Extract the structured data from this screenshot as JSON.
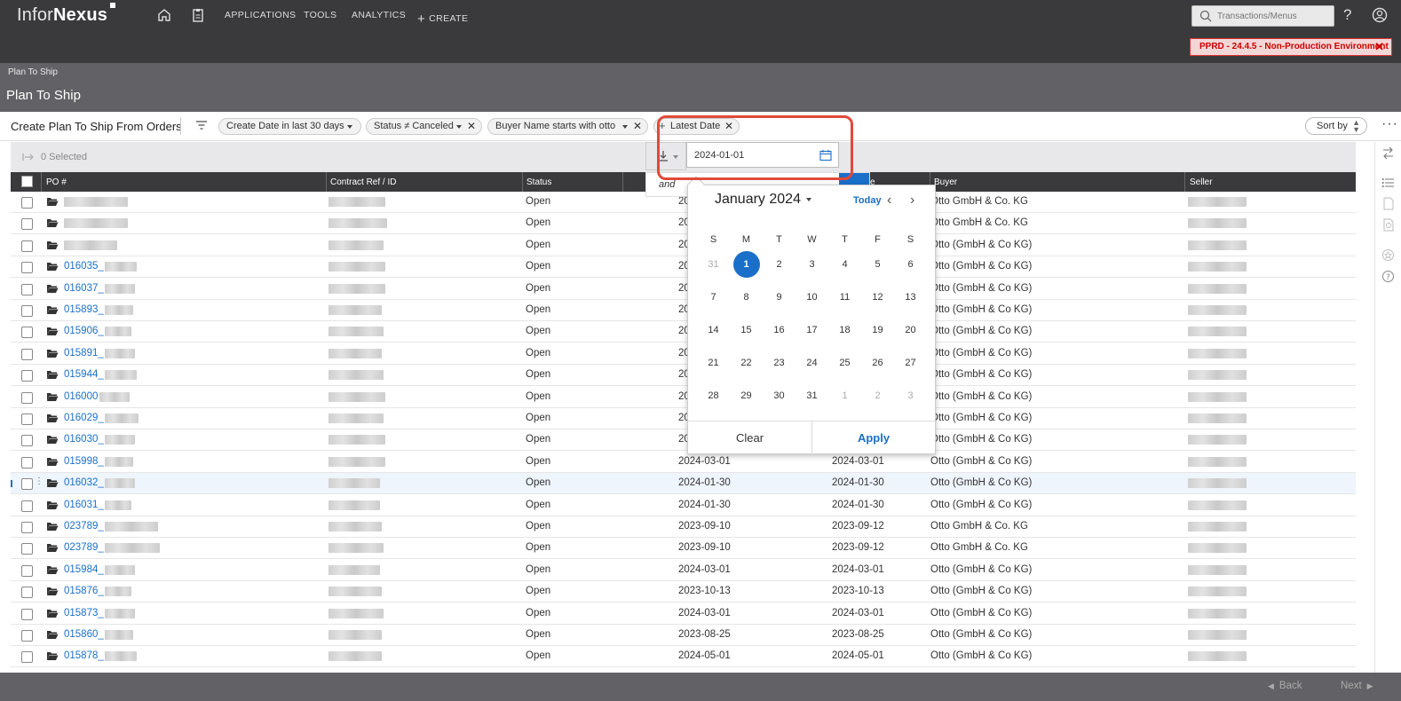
{
  "brand": {
    "part1": "Infor",
    "part2": "Nexus"
  },
  "nav": {
    "applications": "APPLICATIONS",
    "tools": "TOOLS",
    "analytics": "ANALYTICS",
    "create": "CREATE"
  },
  "search": {
    "placeholder": "Transactions/Menus"
  },
  "env_badge": "PPRD - 24.4.5 - Non-Production Environment",
  "breadcrumb": "Plan To Ship",
  "page_title": "Plan To Ship",
  "filterbar": {
    "title": "Create Plan To Ship From Orders",
    "chips": {
      "create_date": "Create Date in last 30 days",
      "status": "Status ≠ Canceled",
      "buyer_name": "Buyer Name starts with otto",
      "latest_date": "Latest Date"
    },
    "sort_by": "Sort by"
  },
  "selection": {
    "text": "0 Selected"
  },
  "columns": {
    "po": "PO #",
    "contract": "Contract Ref / ID",
    "status": "Status",
    "col_e": "e",
    "buyer": "Buyer",
    "seller": "Seller"
  },
  "date_filter": {
    "and_label": "and",
    "value": "2024-01-01",
    "calendar": {
      "month": "January 2024",
      "today": "Today",
      "weekdays": [
        "S",
        "M",
        "T",
        "W",
        "T",
        "F",
        "S"
      ],
      "weeks": [
        [
          "31",
          "1",
          "2",
          "3",
          "4",
          "5",
          "6"
        ],
        [
          "7",
          "8",
          "9",
          "10",
          "11",
          "12",
          "13"
        ],
        [
          "14",
          "15",
          "16",
          "17",
          "18",
          "19",
          "20"
        ],
        [
          "21",
          "22",
          "23",
          "24",
          "25",
          "26",
          "27"
        ],
        [
          "28",
          "29",
          "30",
          "31",
          "1",
          "2",
          "3"
        ]
      ],
      "selected_day": "1",
      "clear": "Clear",
      "apply": "Apply"
    }
  },
  "rows": [
    {
      "po": "",
      "status": "Open",
      "d1": "20",
      "d2": "",
      "buyer": "Otto GmbH & Co. KG"
    },
    {
      "po": "",
      "status": "Open",
      "d1": "20",
      "d2": "",
      "buyer": "Otto GmbH & Co. KG"
    },
    {
      "po": "",
      "status": "Open",
      "d1": "20",
      "d2": "",
      "buyer": "Otto (GmbH & Co KG)"
    },
    {
      "po": "016035_",
      "status": "Open",
      "d1": "20",
      "d2": "",
      "buyer": "Otto (GmbH & Co KG)"
    },
    {
      "po": "016037_",
      "status": "Open",
      "d1": "20",
      "d2": "",
      "buyer": "Otto (GmbH & Co KG)"
    },
    {
      "po": "015893_",
      "status": "Open",
      "d1": "20",
      "d2": "",
      "buyer": "Otto (GmbH & Co KG)"
    },
    {
      "po": "015906_",
      "status": "Open",
      "d1": "20",
      "d2": "",
      "buyer": "Otto (GmbH & Co KG)"
    },
    {
      "po": "015891_",
      "status": "Open",
      "d1": "20",
      "d2": "",
      "buyer": "Otto (GmbH & Co KG)"
    },
    {
      "po": "015944_",
      "status": "Open",
      "d1": "20",
      "d2": "",
      "buyer": "Otto (GmbH & Co KG)"
    },
    {
      "po": "016000",
      "status": "Open",
      "d1": "20",
      "d2": "",
      "buyer": "Otto (GmbH & Co KG)"
    },
    {
      "po": "016029_",
      "status": "Open",
      "d1": "20",
      "d2": "",
      "buyer": "Otto (GmbH & Co KG)"
    },
    {
      "po": "016030_",
      "status": "Open",
      "d1": "20",
      "d2": "",
      "buyer": "Otto (GmbH & Co KG)"
    },
    {
      "po": "015998_",
      "status": "Open",
      "d1": "2024-03-01",
      "d2": "2024-03-01",
      "buyer": "Otto (GmbH & Co KG)"
    },
    {
      "po": "016032_",
      "status": "Open",
      "d1": "2024-01-30",
      "d2": "2024-01-30",
      "buyer": "Otto (GmbH & Co KG)"
    },
    {
      "po": "016031_",
      "status": "Open",
      "d1": "2024-01-30",
      "d2": "2024-01-30",
      "buyer": "Otto (GmbH & Co KG)"
    },
    {
      "po": "023789_",
      "status": "Open",
      "d1": "2023-09-10",
      "d2": "2023-09-12",
      "buyer": "Otto GmbH & Co. KG"
    },
    {
      "po": "023789_",
      "status": "Open",
      "d1": "2023-09-10",
      "d2": "2023-09-12",
      "buyer": "Otto GmbH & Co. KG"
    },
    {
      "po": "015984_",
      "status": "Open",
      "d1": "2024-03-01",
      "d2": "2024-03-01",
      "buyer": "Otto (GmbH & Co KG)"
    },
    {
      "po": "015876_",
      "status": "Open",
      "d1": "2023-10-13",
      "d2": "2023-10-13",
      "buyer": "Otto (GmbH & Co KG)"
    },
    {
      "po": "015873_",
      "status": "Open",
      "d1": "2024-03-01",
      "d2": "2024-03-01",
      "buyer": "Otto (GmbH & Co KG)"
    },
    {
      "po": "015860_",
      "status": "Open",
      "d1": "2023-08-25",
      "d2": "2023-08-25",
      "buyer": "Otto (GmbH & Co KG)"
    },
    {
      "po": "015878_",
      "status": "Open",
      "d1": "2024-05-01",
      "d2": "2024-05-01",
      "buyer": "Otto (GmbH & Co KG)"
    }
  ],
  "highlighted_row": 13,
  "footer": {
    "back": "Back",
    "next": "Next"
  }
}
